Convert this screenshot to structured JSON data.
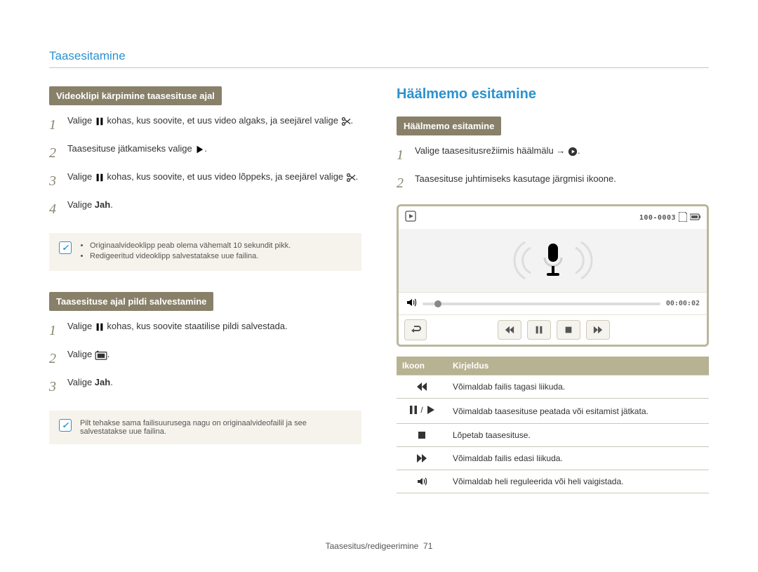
{
  "page": {
    "title": "Taasesitamine",
    "footer_label": "Taasesitus/redigeerimine",
    "footer_page": "71"
  },
  "left": {
    "section1": {
      "bar": "Videoklipi kärpimine taasesituse ajal",
      "steps": {
        "s1_a": "Valige ",
        "s1_b": " kohas, kus soovite, et uus video algaks, ja seejärel valige ",
        "s1_c": ".",
        "s2_a": "Taasesituse jätkamiseks valige ",
        "s2_b": ".",
        "s3_a": "Valige ",
        "s3_b": " kohas, kus soovite, et uus video lõppeks, ja seejärel valige ",
        "s3_c": ".",
        "s4_a": "Valige ",
        "s4_b": "Jah",
        "s4_c": "."
      },
      "note": {
        "li1": "Originaalvideoklipp peab olema vähemalt 10 sekundit pikk.",
        "li2": "Redigeeritud videoklipp salvestatakse uue failina."
      }
    },
    "section2": {
      "bar": "Taasesituse ajal pildi salvestamine",
      "steps": {
        "s1_a": "Valige ",
        "s1_b": " kohas, kus soovite staatilise pildi salvestada.",
        "s2_a": "Valige ",
        "s2_b": ".",
        "s3_a": "Valige ",
        "s3_b": "Jah",
        "s3_c": "."
      },
      "note": "Pilt tehakse sama failisuurusega nagu on originaalvideofailil ja see salvestatakse uue failina."
    }
  },
  "right": {
    "heading": "Häälmemo esitamine",
    "section": {
      "bar": "Häälmemo esitamine",
      "steps": {
        "s1_a": "Valige taasesitusrežiimis häälmälu → ",
        "s1_b": ".",
        "s2": "Taasesituse juhtimiseks kasutage järgmisi ikoone."
      }
    },
    "device": {
      "header_right": "100-0003",
      "time": "00:00:02"
    },
    "table": {
      "th_icon": "Ikoon",
      "th_desc": "Kirjeldus",
      "r1": "Võimaldab failis tagasi liikuda.",
      "r2": "Võimaldab taasesituse peatada või esitamist jätkata.",
      "r3": "Lõpetab taasesituse.",
      "r4": "Võimaldab failis edasi liikuda.",
      "r5": "Võimaldab heli reguleerida või heli vaigistada."
    }
  }
}
